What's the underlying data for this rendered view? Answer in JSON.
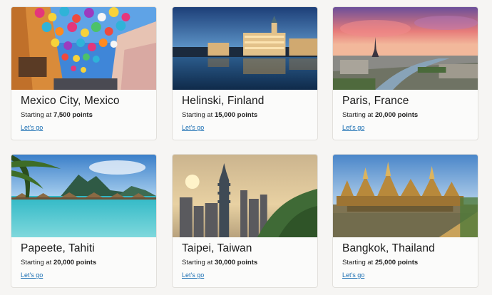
{
  "destinations": [
    {
      "city": "Mexico City, Mexico",
      "price_prefix": "Starting at",
      "points": "7,500 points",
      "cta": "Let's go"
    },
    {
      "city": "Helinski, Finland",
      "price_prefix": "Starting at",
      "points": "15,000 points",
      "cta": "Let's go"
    },
    {
      "city": "Paris, France",
      "price_prefix": "Starting at",
      "points": "20,000 points",
      "cta": "Let's go"
    },
    {
      "city": "Papeete, Tahiti",
      "price_prefix": "Starting at",
      "points": "20,000 points",
      "cta": "Let's go"
    },
    {
      "city": "Taipei, Taiwan",
      "price_prefix": "Starting at",
      "points": "30,000 points",
      "cta": "Let's go"
    },
    {
      "city": "Bangkok, Thailand",
      "price_prefix": "Starting at",
      "points": "25,000 points",
      "cta": "Let's go"
    }
  ]
}
